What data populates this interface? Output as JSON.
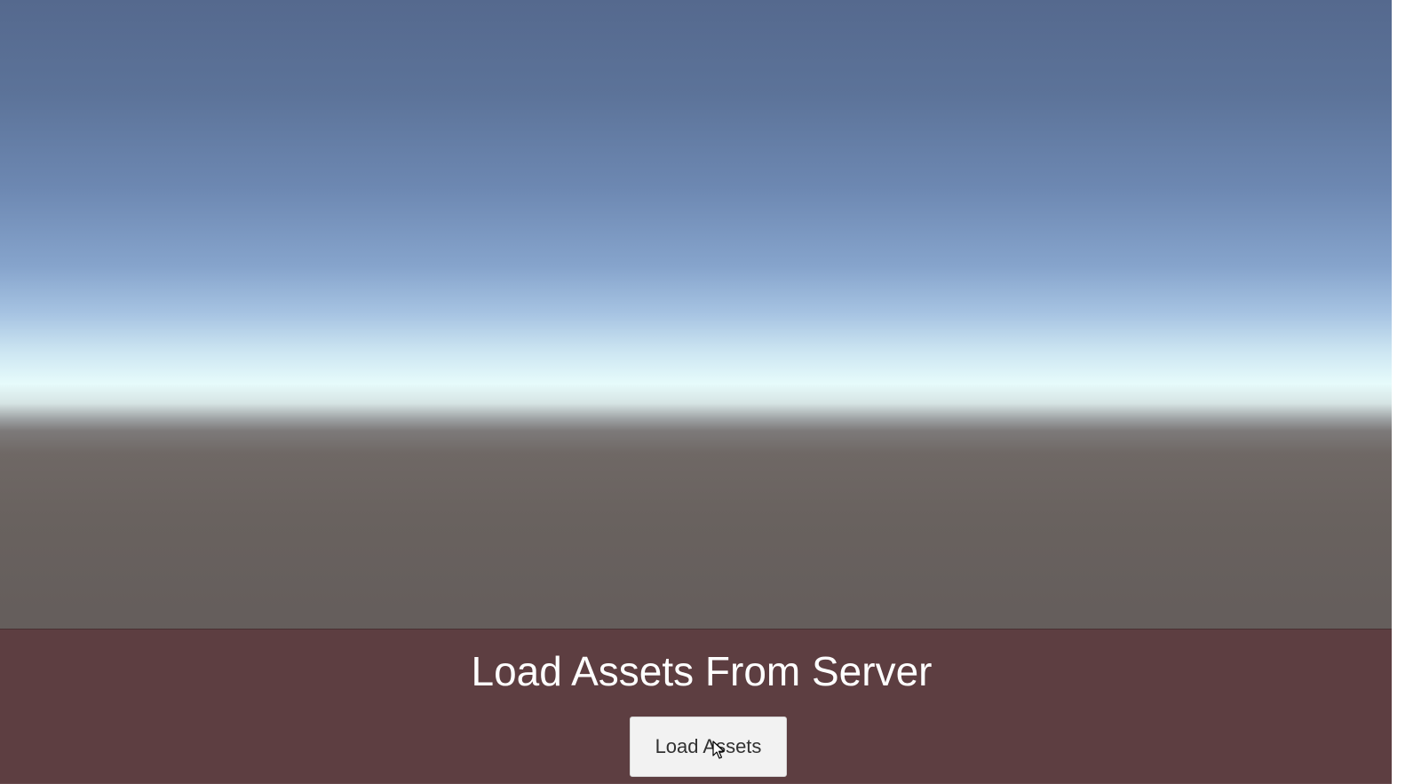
{
  "scene": {
    "sky_top_color": "#55698e",
    "horizon_color": "#e6fbfb",
    "ground_color": "#655e5c"
  },
  "panel": {
    "title": "Load Assets From Server",
    "background_color": "#5c3c40",
    "button": {
      "label": "Load Assets"
    }
  },
  "cursor": {
    "icon": "mouse-pointer-icon"
  }
}
